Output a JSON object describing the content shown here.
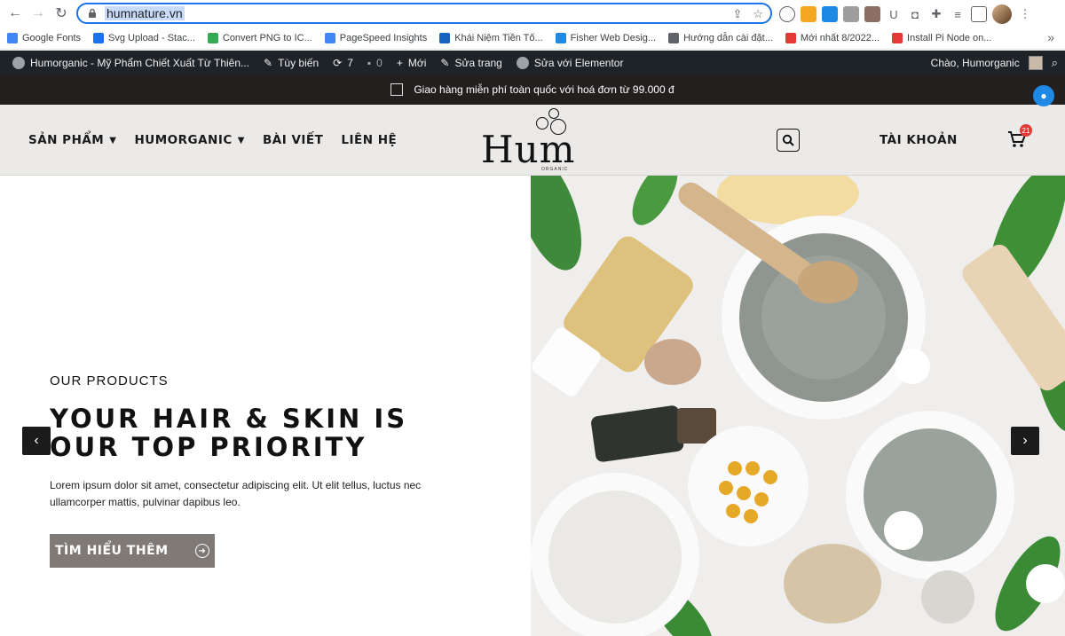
{
  "browser": {
    "url": "humnature.vn",
    "bookmarks": [
      {
        "label": "Google Fonts",
        "color": "#4285f4"
      },
      {
        "label": "Svg Upload - Stac...",
        "color": "#1a73e8"
      },
      {
        "label": "Convert PNG to IC...",
        "color": "#34a853"
      },
      {
        "label": "PageSpeed Insights",
        "color": "#4285f4"
      },
      {
        "label": "Khái Niệm Tiền Tố...",
        "color": "#1565c0"
      },
      {
        "label": "Fisher Web Desig...",
        "color": "#1e88e5"
      },
      {
        "label": "Hướng dẫn cài đặt...",
        "color": "#5f6368"
      },
      {
        "label": "Mới nhất 8/2022...",
        "color": "#e53935"
      },
      {
        "label": "Install Pi Node on...",
        "color": "#e53935"
      }
    ],
    "more_bookmarks": "»"
  },
  "wp_admin": {
    "site_title": "Humorganic - Mỹ Phẩm Chiết Xuất Từ Thiên...",
    "customize": "Tùy biến",
    "updates": "7",
    "comments": "0",
    "new": "Mới",
    "edit_page": "Sửa trang",
    "edit_elementor": "Sửa với Elementor",
    "greeting": "Chào, Humorganic"
  },
  "promo": {
    "text": "Giao hàng miễn phí toàn quốc với hoá đơn từ 99.000 đ"
  },
  "header": {
    "menu": [
      {
        "label": "SẢN PHẨM",
        "has_dropdown": true
      },
      {
        "label": "HUMORGANIC",
        "has_dropdown": true
      },
      {
        "label": "BÀI VIẾT",
        "has_dropdown": false
      },
      {
        "label": "LIÊN HỆ",
        "has_dropdown": false
      }
    ],
    "logo_text": "Hum",
    "logo_subtext": "ORGANIC",
    "account": "TÀI KHOẢN",
    "cart_count": "21"
  },
  "hero": {
    "eyebrow": "OUR PRODUCTS",
    "headline": "YOUR HAIR & SKIN IS OUR TOP PRIORITY",
    "description": "Lorem ipsum dolor sit amet, consectetur adipiscing elit. Ut elit tellus, luctus nec ullamcorper mattis, pulvinar dapibus leo.",
    "cta": "TÌM HIỂU THÊM",
    "prev": "‹",
    "next": "›"
  },
  "colors": {
    "header_bg": "#eceae8",
    "promo_bg": "#231f1e",
    "cta_bg": "#7f7a76",
    "wp_bar": "#1d2327"
  }
}
